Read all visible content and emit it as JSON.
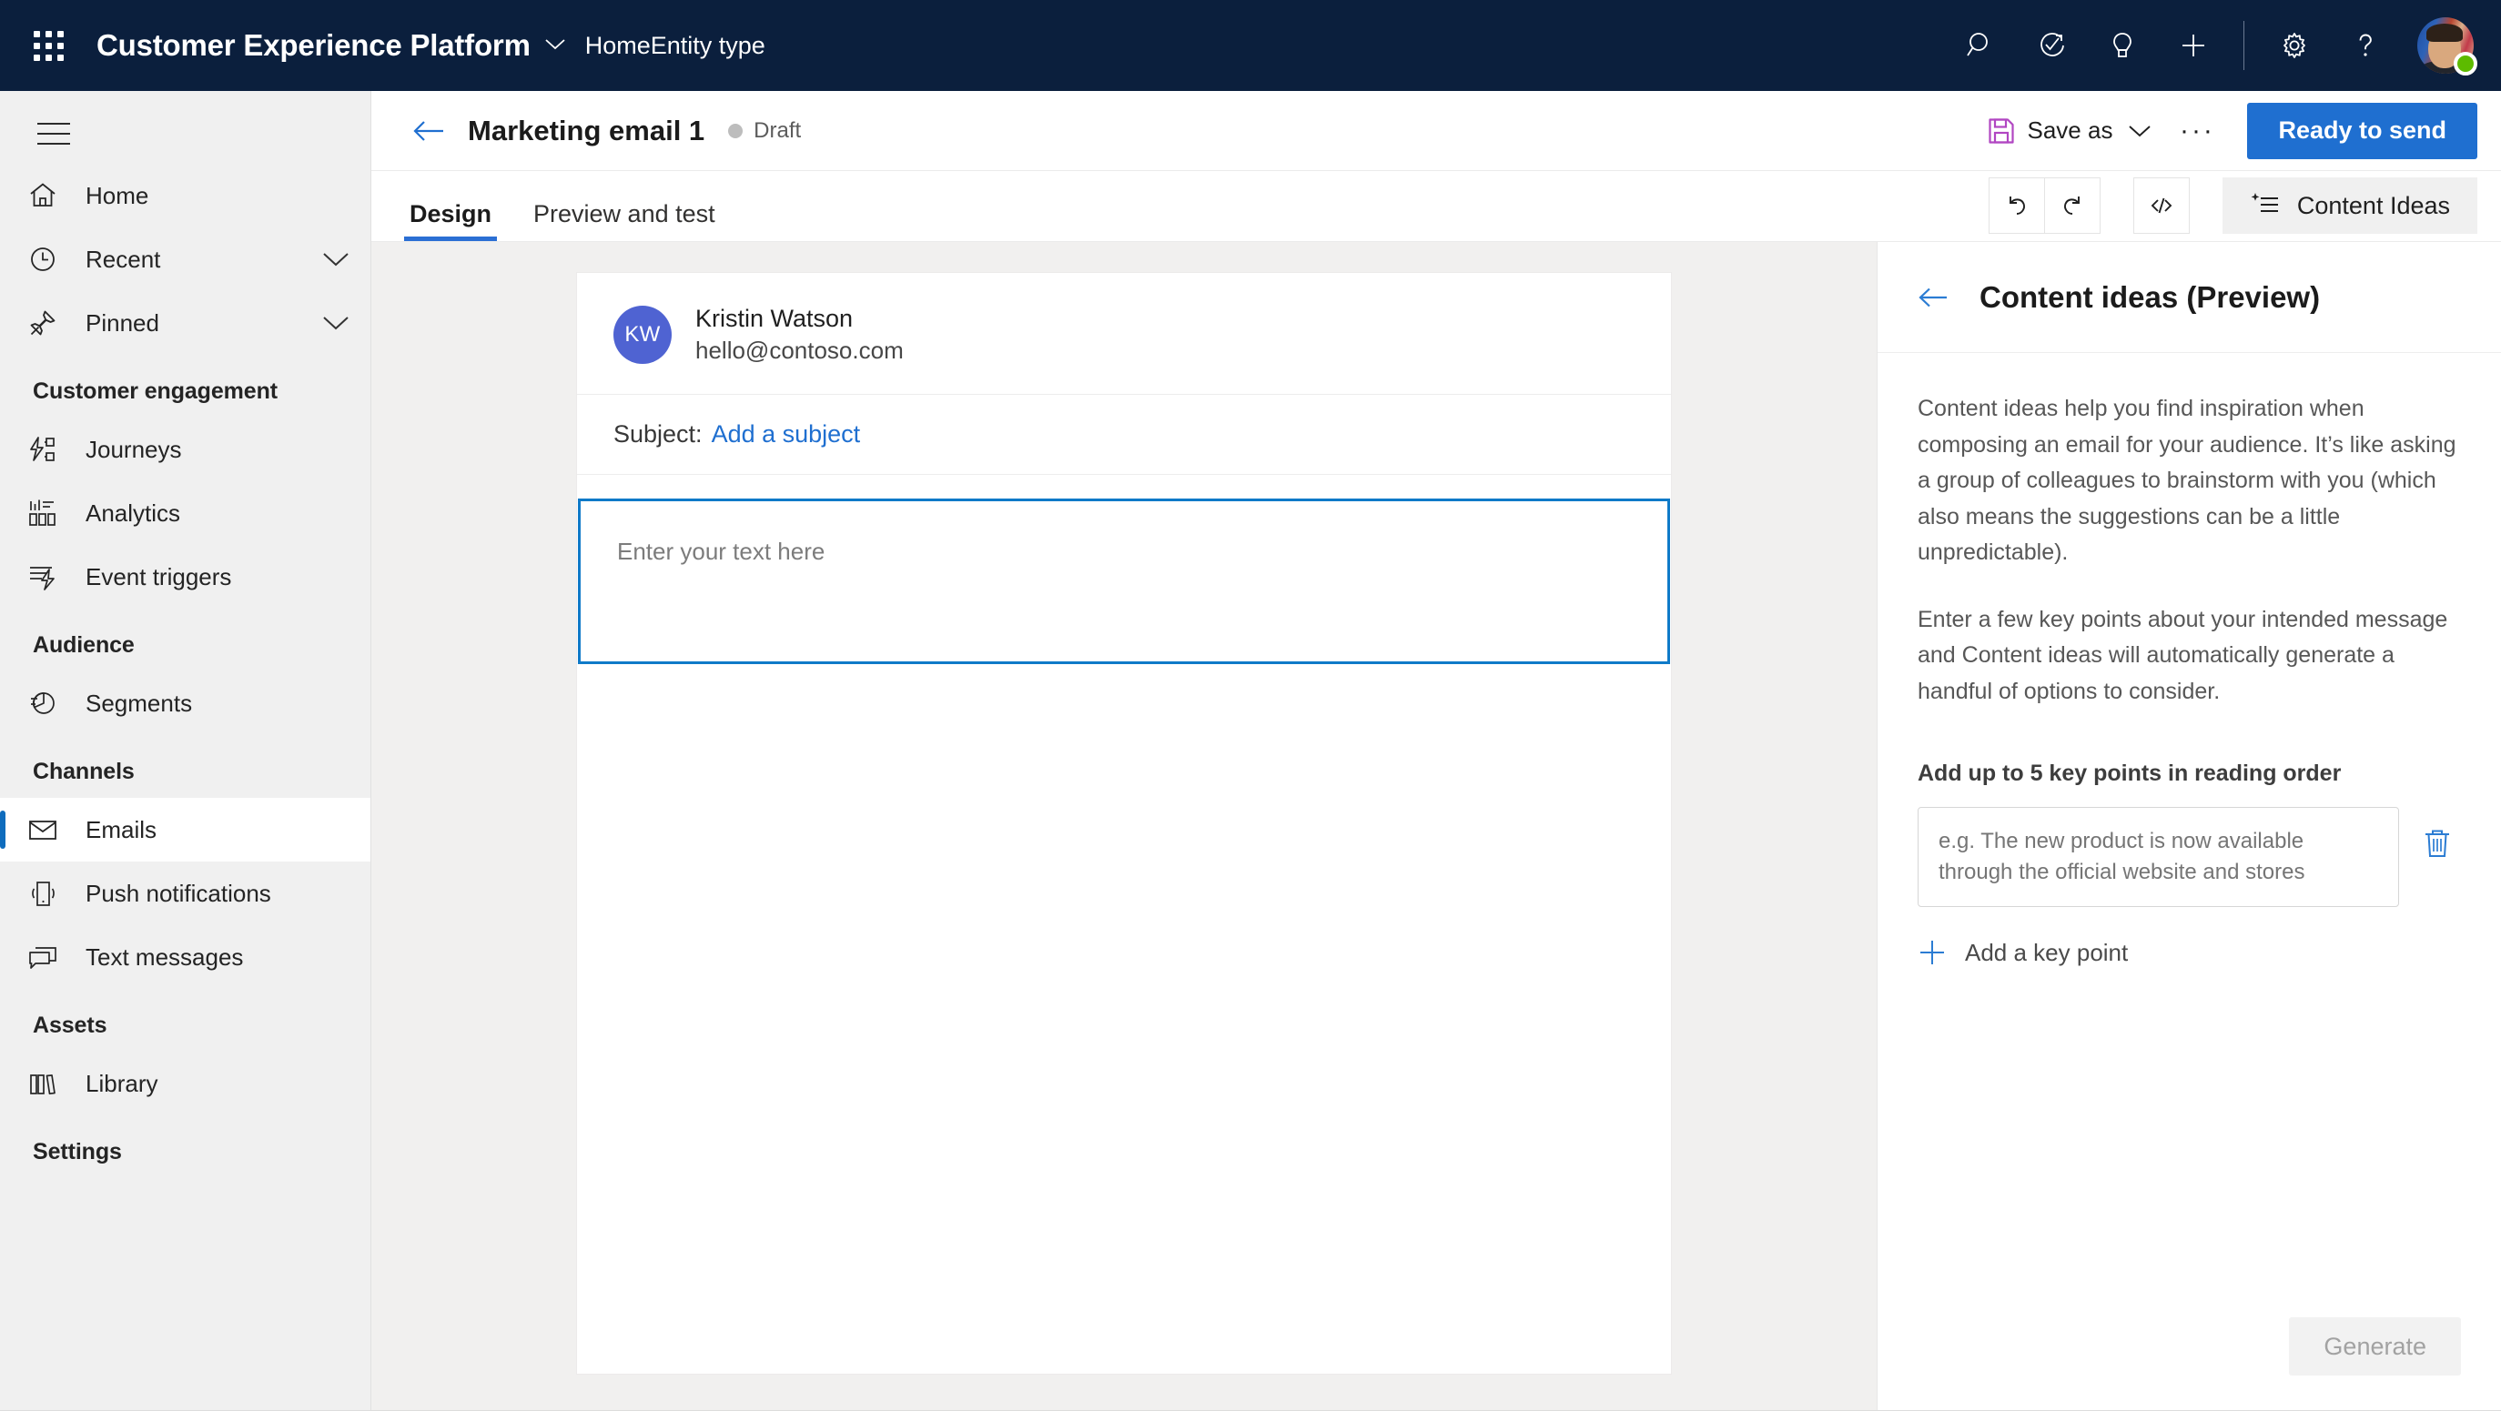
{
  "topbar": {
    "waffle_icon": "app-launcher-icon",
    "app_title": "Customer Experience Platform",
    "app_chevron": "chevron-down-icon",
    "breadcrumb": "HomeEntity type",
    "actions": [
      {
        "name": "search-icon",
        "label": "Search"
      },
      {
        "name": "assistant-icon",
        "label": "Assistant"
      },
      {
        "name": "lightbulb-icon",
        "label": "Ideas"
      },
      {
        "name": "plus-icon",
        "label": "New"
      },
      {
        "name": "gear-icon",
        "label": "Settings"
      },
      {
        "name": "help-icon",
        "label": "Help"
      }
    ],
    "avatar_presence": "available"
  },
  "sidebar": {
    "hamburger_icon": "hamburger-menu-icon",
    "items": [
      {
        "label": "Home",
        "icon": "home-icon",
        "expandable": false,
        "selected": false
      },
      {
        "label": "Recent",
        "icon": "clock-icon",
        "expandable": true,
        "selected": false
      },
      {
        "label": "Pinned",
        "icon": "pin-icon",
        "expandable": true,
        "selected": false
      }
    ],
    "groups": [
      {
        "title": "Customer engagement",
        "items": [
          {
            "label": "Journeys",
            "icon": "journeys-icon",
            "selected": false
          },
          {
            "label": "Analytics",
            "icon": "analytics-icon",
            "selected": false
          },
          {
            "label": "Event triggers",
            "icon": "event-triggers-icon",
            "selected": false
          }
        ]
      },
      {
        "title": "Audience",
        "items": [
          {
            "label": "Segments",
            "icon": "segments-pie-icon",
            "selected": false
          }
        ]
      },
      {
        "title": "Channels",
        "items": [
          {
            "label": "Emails",
            "icon": "envelope-icon",
            "selected": true
          },
          {
            "label": "Push notifications",
            "icon": "phone-push-icon",
            "selected": false
          },
          {
            "label": "Text messages",
            "icon": "chat-bubble-icon",
            "selected": false
          }
        ]
      },
      {
        "title": "Assets",
        "items": [
          {
            "label": "Library",
            "icon": "library-books-icon",
            "selected": false
          }
        ]
      },
      {
        "title": "Settings",
        "items": []
      }
    ]
  },
  "commandbar": {
    "back_icon": "back-arrow-icon",
    "title": "Marketing email 1",
    "status": "Draft",
    "save_icon": "save-floppy-icon",
    "save_label": "Save as",
    "save_chevron": "chevron-down-icon",
    "overflow_label": "···",
    "primary_label": "Ready to send"
  },
  "tabs": [
    {
      "label": "Design",
      "active": true
    },
    {
      "label": "Preview and test",
      "active": false
    }
  ],
  "toolbar": {
    "undo_icon": "undo-icon",
    "redo_icon": "redo-icon",
    "code_icon": "code-brackets-icon",
    "content_ideas_icon": "content-ideas-sparkle-icon",
    "content_ideas_label": "Content Ideas"
  },
  "email": {
    "sender_initials": "KW",
    "sender_name": "Kristin Watson",
    "sender_email": "hello@contoso.com",
    "subject_label": "Subject:",
    "subject_link": "Add a subject",
    "body_placeholder": "Enter your text here"
  },
  "panel": {
    "back_icon": "back-arrow-icon",
    "title": "Content ideas (Preview)",
    "paragraph1": "Content ideas help you find inspiration when composing an email for your audience. It’s like asking a group of colleagues to brainstorm with you (which also means the suggestions can be a little unpredictable).",
    "paragraph2": "Enter a few key points about your intended message and Content ideas will automatically generate a handful of options to consider.",
    "subheading": "Add up to 5 key points in reading order",
    "keypoint_placeholder": "e.g. The new product is now available through the official website and stores",
    "keypoint_value": "",
    "delete_icon": "trash-icon",
    "add_icon": "plus-icon",
    "add_label": "Add a key point",
    "generate_label": "Generate"
  },
  "colors": {
    "header_bg": "#0b1f3d",
    "accent_blue": "#1f6fd0",
    "sidebar_bg": "#f0f0f0",
    "canvas_bg": "#f1f0ef",
    "selected_bar": "#0f6cbd",
    "save_icon": "#b146c2",
    "presence_green": "#5dbb00",
    "avatar_blue": "#4f63d2",
    "focus_border": "#0f7ac8"
  }
}
